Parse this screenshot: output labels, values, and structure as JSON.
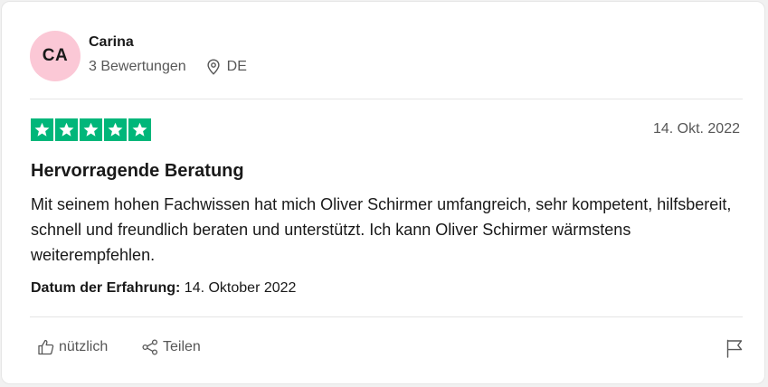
{
  "consumer": {
    "initials": "CA",
    "name": "Carina",
    "reviews_count": "3 Bewertungen",
    "country": "DE",
    "avatar_color": "#fbc8d6"
  },
  "review": {
    "rating": 5,
    "rating_max": 5,
    "star_color": "#00b67a",
    "date": "14. Okt. 2022",
    "title": "Hervorragende Beratung",
    "text": "Mit seinem hohen Fachwissen hat mich Oliver Schirmer umfangreich, sehr kompetent, hilfsbereit, schnell und freundlich beraten und unterstützt. Ich kann Oliver Schirmer wärmstens weiterempfehlen.",
    "experience_label": "Datum der Erfahrung:",
    "experience_date": "14. Oktober 2022"
  },
  "actions": {
    "useful_label": "nützlich",
    "share_label": "Teilen",
    "useful_icon": "thumbs-up-icon",
    "share_icon": "share-icon",
    "flag_icon": "flag-icon"
  }
}
